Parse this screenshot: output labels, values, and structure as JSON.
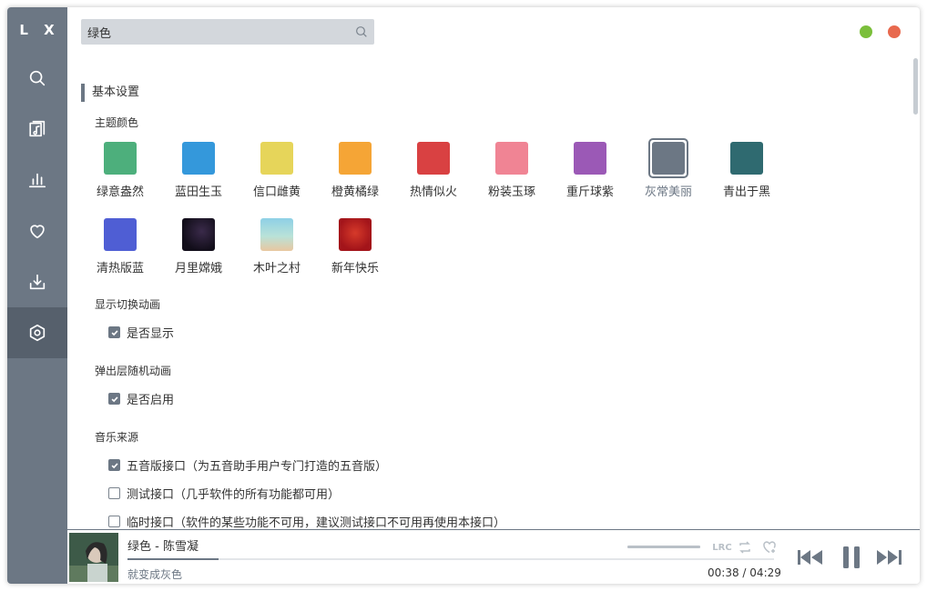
{
  "app": {
    "logo": "L X"
  },
  "search": {
    "value": "绿色"
  },
  "sidebar": {
    "items": [
      {
        "icon": "search-icon"
      },
      {
        "icon": "music-list-icon"
      },
      {
        "icon": "chart-icon"
      },
      {
        "icon": "heart-icon"
      },
      {
        "icon": "download-icon"
      },
      {
        "icon": "settings-icon",
        "active": true
      }
    ]
  },
  "settings": {
    "section_title": "基本设置",
    "theme_label": "主题颜色",
    "themes": [
      {
        "name": "绿意盎然",
        "color": "#4daf7c"
      },
      {
        "name": "蓝田生玉",
        "color": "#3498db"
      },
      {
        "name": "信口雌黄",
        "color": "#e6d55a"
      },
      {
        "name": "橙黄橘绿",
        "color": "#f5a536"
      },
      {
        "name": "热情似火",
        "color": "#d94142"
      },
      {
        "name": "粉装玉琢",
        "color": "#f08494"
      },
      {
        "name": "重斤球紫",
        "color": "#9b59b6"
      },
      {
        "name": "灰常美丽",
        "color": "#6c7784",
        "selected": true
      },
      {
        "name": "青出于黑",
        "color": "#2f6a70"
      },
      {
        "name": "清热版蓝",
        "color": "#4f5ed4"
      },
      {
        "name": "月里嫦娥",
        "color": "#1e1a2a"
      },
      {
        "name": "木叶之村",
        "color": "#8fcfe0"
      },
      {
        "name": "新年快乐",
        "color": "#b51a1a"
      }
    ],
    "animation_label": "显示切换动画",
    "animation_option": "是否显示",
    "animation_checked": true,
    "popup_label": "弹出层随机动画",
    "popup_option": "是否启用",
    "popup_checked": true,
    "source_label": "音乐来源",
    "sources": [
      {
        "label": "五音版接口（为五音助手用户专门打造的五音版）",
        "checked": true
      },
      {
        "label": "测试接口（几乎软件的所有功能都可用）",
        "checked": false
      },
      {
        "label": "临时接口（软件的某些功能不可用，建议测试接口不可用再使用本接口）",
        "checked": false
      }
    ]
  },
  "player": {
    "title": "绿色 - 陈雪凝",
    "lyric": "就变成灰色",
    "current_time": "00:38",
    "separator": "/",
    "total_time": "04:29",
    "progress": 0.141,
    "volume": 1.0,
    "lrc_label": "LRC"
  },
  "colors": {
    "accent": "#6c7784",
    "min_button": "#7bbf3b",
    "close_button": "#e8694e"
  }
}
